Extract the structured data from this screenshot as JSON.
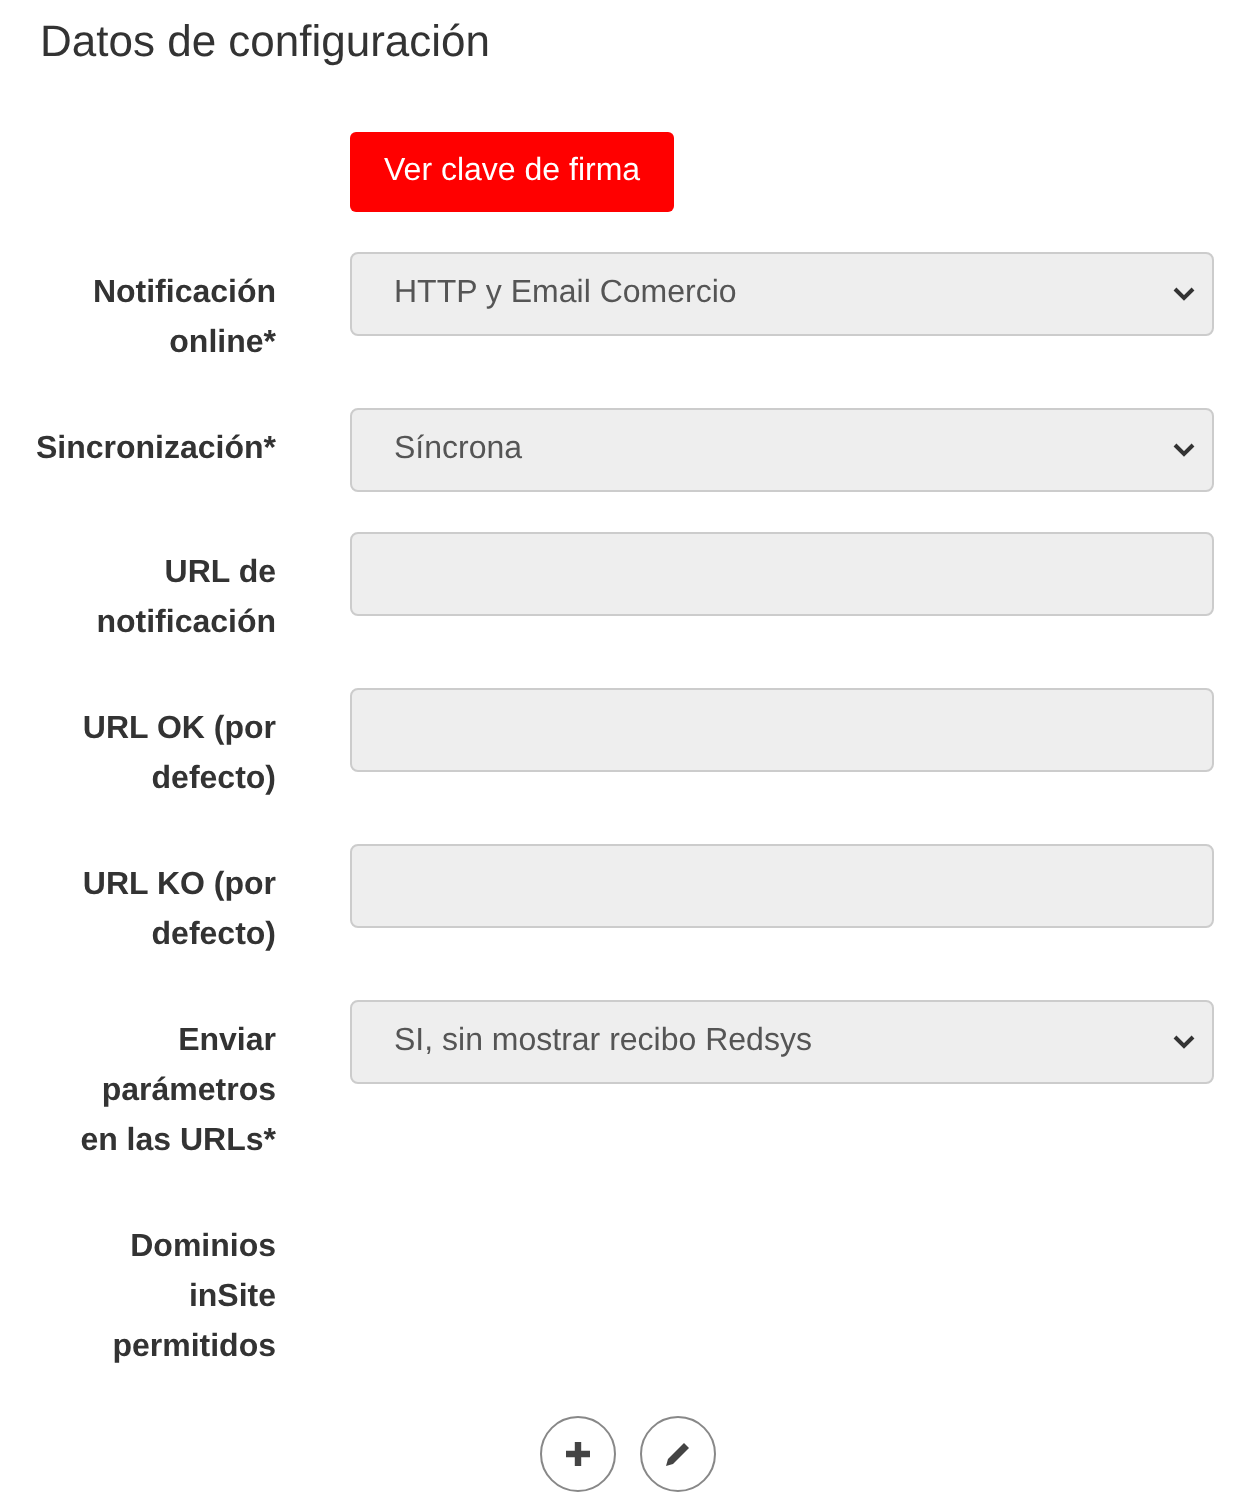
{
  "title": "Datos de configuración",
  "key_button": "Ver clave de firma",
  "fields": [
    {
      "label": "Notificación online*",
      "kind": "select",
      "value": "HTTP y Email Comercio",
      "disabled": true
    },
    {
      "label": "Sincronización*",
      "kind": "select",
      "value": "Síncrona",
      "disabled": true
    },
    {
      "label": "URL de notificación",
      "kind": "input",
      "disabled": true
    },
    {
      "label": "URL OK (por defecto)",
      "kind": "input",
      "disabled": true
    },
    {
      "label": "URL KO (por defecto)",
      "kind": "input",
      "disabled": true
    },
    {
      "label": "Enviar parámetros en las URLs*",
      "kind": "select",
      "value": "SI, sin mostrar recibo Redsys",
      "disabled": true
    },
    {
      "label": "Dominios inSite permitidos",
      "kind": "none"
    }
  ],
  "actions": [
    {
      "kind": "add"
    },
    {
      "kind": "edit"
    }
  ]
}
